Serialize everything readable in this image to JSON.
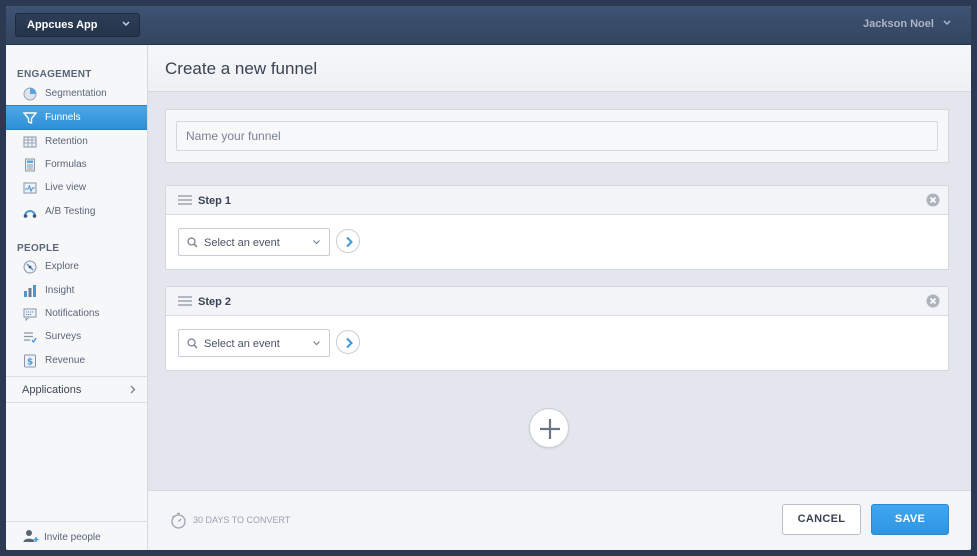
{
  "topbar": {
    "app_name": "Appcues App",
    "user_name": "Jackson Noel"
  },
  "sidebar": {
    "engagement_title": "ENGAGEMENT",
    "engagement_items": [
      {
        "label": "Segmentation",
        "icon": "pie-chart-icon"
      },
      {
        "label": "Funnels",
        "icon": "funnel-icon",
        "active": true
      },
      {
        "label": "Retention",
        "icon": "grid-table-icon"
      },
      {
        "label": "Formulas",
        "icon": "calculator-icon"
      },
      {
        "label": "Live view",
        "icon": "pulse-icon"
      },
      {
        "label": "A/B Testing",
        "icon": "ab-test-icon"
      }
    ],
    "people_title": "PEOPLE",
    "people_items": [
      {
        "label": "Explore",
        "icon": "compass-icon"
      },
      {
        "label": "Insight",
        "icon": "bar-chart-icon"
      },
      {
        "label": "Notifications",
        "icon": "message-icon"
      },
      {
        "label": "Surveys",
        "icon": "survey-list-icon"
      },
      {
        "label": "Revenue",
        "icon": "dollar-icon"
      }
    ],
    "applications_label": "Applications",
    "invite_label": "Invite people"
  },
  "main": {
    "title": "Create a new funnel",
    "name_placeholder": "Name your funnel",
    "name_value": "",
    "steps": [
      {
        "title": "Step 1",
        "event_placeholder": "Select an event"
      },
      {
        "title": "Step 2",
        "event_placeholder": "Select an event"
      }
    ]
  },
  "footer": {
    "convert_label": "30 DAYS TO CONVERT",
    "cancel_label": "CANCEL",
    "save_label": "SAVE"
  },
  "colors": {
    "accent": "#2f95e3",
    "topbar": "#3a4d6b",
    "sidebar_active": "#3d9ee3"
  }
}
